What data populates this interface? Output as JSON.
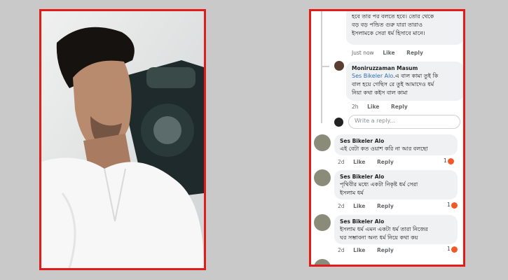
{
  "colors": {
    "frame": "#e21b1b",
    "link": "#2f6fb5",
    "bubble": "#eff1f3",
    "react": "#f05a29"
  },
  "photo": {
    "icon": "person-photo"
  },
  "comments": {
    "c0": {
      "lines": [
        "হবে তার পর বলতে হবে। তোর থেকে",
        "বড় বড় পন্ডিত গুরু যারা তারাও",
        "ইসলামকে সেরা ধর্ম হিসাবে মানে।"
      ],
      "time": "Just now",
      "like": "Like",
      "reply": "Reply"
    },
    "c1": {
      "name": "Moniruzzaman Masum",
      "tag": "Ses Bikeler Alo",
      "line1_rest": ".এ বাল কামা তুই কি",
      "line2": "বাল হয়ে গেছিস রে তুই আমাদেও ধর্ম",
      "line3": "নিয়া কথা কইস বাল কামা",
      "time": "2h",
      "like": "Like",
      "reply": "Reply"
    },
    "reply_placeholder": "Write a reply...",
    "c2": {
      "name": "Ses Bikeler Alo",
      "lines": [
        "এই বেটা কত ওয়াশ করি না আর বলছো"
      ],
      "time": "2d",
      "like": "Like",
      "reply": "Reply",
      "reactions": "1"
    },
    "c3": {
      "name": "Ses Bikeler Alo",
      "lines": [
        "পৃথিবীর মধ্যে একটা নিকৃষ্ট ধর্ম সেরা",
        "ইসলাম ধর্ম"
      ],
      "time": "2d",
      "like": "Like",
      "reply": "Reply",
      "reactions": "1"
    },
    "c4": {
      "name": "Ses Bikeler Alo",
      "lines": [
        "ইসলাম ধর্ম এমন একটা ধর্ম তারা নিজের",
        "ঘর সম্ভাবনা অন্য ধর্ম নিয়ে কথা কয়"
      ],
      "time": "2d",
      "like": "Like",
      "reply": "Reply",
      "reactions": "1"
    }
  }
}
